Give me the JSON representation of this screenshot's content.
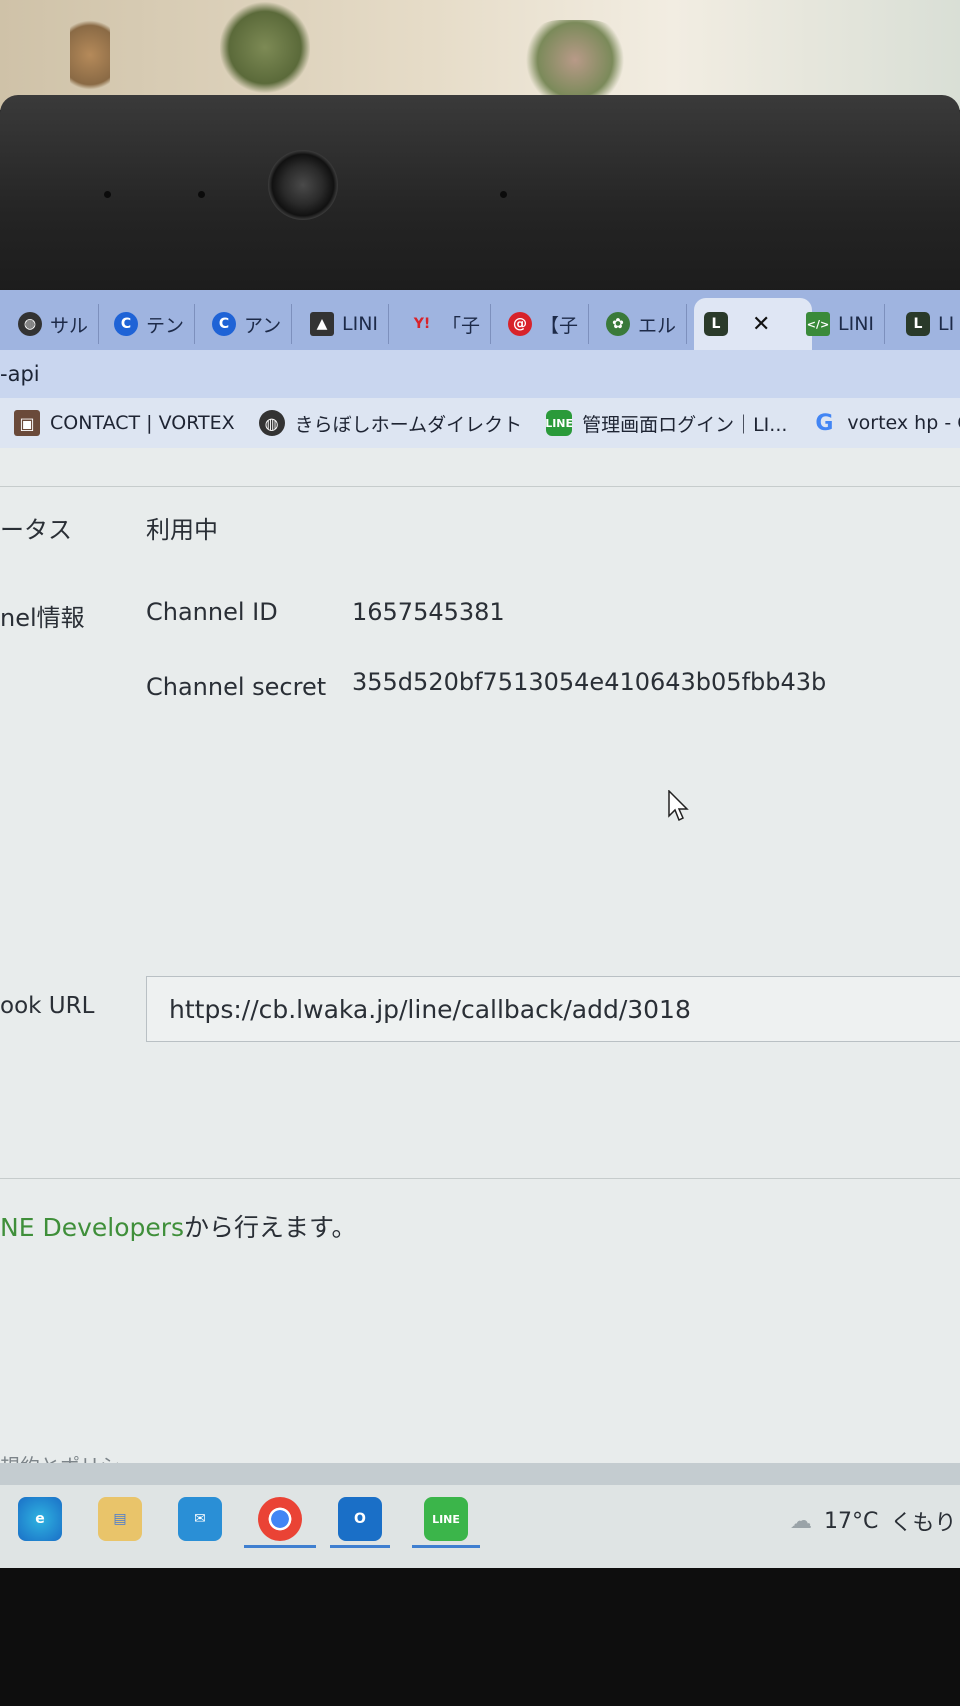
{
  "tabs": [
    {
      "label": "サル",
      "icon": "globe-icon",
      "color": "#333333"
    },
    {
      "label": "テン",
      "icon": "c-logo-icon",
      "color": "#1f63d6"
    },
    {
      "label": "アン",
      "icon": "c-logo-icon",
      "color": "#1f63d6"
    },
    {
      "label": "LINI",
      "icon": "dark-square-icon",
      "color": "#333333"
    },
    {
      "label": "「子",
      "icon": "yahoo-icon",
      "color": "#d8232a"
    },
    {
      "label": "【子",
      "icon": "red-c-icon",
      "color": "#d8232a"
    },
    {
      "label": "エル",
      "icon": "frog-icon",
      "color": "#3a7a3a"
    },
    {
      "label": "",
      "icon": "l-shield-icon",
      "color": "#2a3a2a",
      "active": true
    },
    {
      "label": "LINI",
      "icon": "code-icon",
      "color": "#3a8a3a"
    },
    {
      "label": "LI",
      "icon": "l-shield-icon",
      "color": "#2a3a2a"
    }
  ],
  "address": {
    "text": "-api"
  },
  "bookmarks": [
    {
      "label": "CONTACT | VORTEX",
      "icon": "photo-icon"
    },
    {
      "label": "きらぼしホームダイレクト",
      "icon": "globe-icon"
    },
    {
      "label": "管理画面ログイン｜LI...",
      "icon": "line-icon"
    },
    {
      "label": "vortex hp - Google...",
      "icon": "google-icon"
    }
  ],
  "fields": {
    "status_label": "ータス",
    "status_value": "利用中",
    "channel_label": "nel情報",
    "channel_id_label": "Channel ID",
    "channel_id_value": "1657545381",
    "channel_secret_label": "Channel secret",
    "channel_secret_value": "355d520bf7513054e410643b05fbb43b",
    "webhook_label": "ook URL",
    "webhook_value": "https://cb.lwaka.jp/line/callback/add/3018"
  },
  "note": {
    "link": "NE Developers",
    "rest": "から行えます。"
  },
  "footer": {
    "policy_link": "規約とポリシー"
  },
  "taskbar": {
    "apps": [
      "edge-icon",
      "file-explorer-icon",
      "mail-icon",
      "chrome-icon",
      "outlook-icon",
      "line-icon"
    ],
    "weather_temp": "17°C",
    "weather_text": "くもり"
  }
}
